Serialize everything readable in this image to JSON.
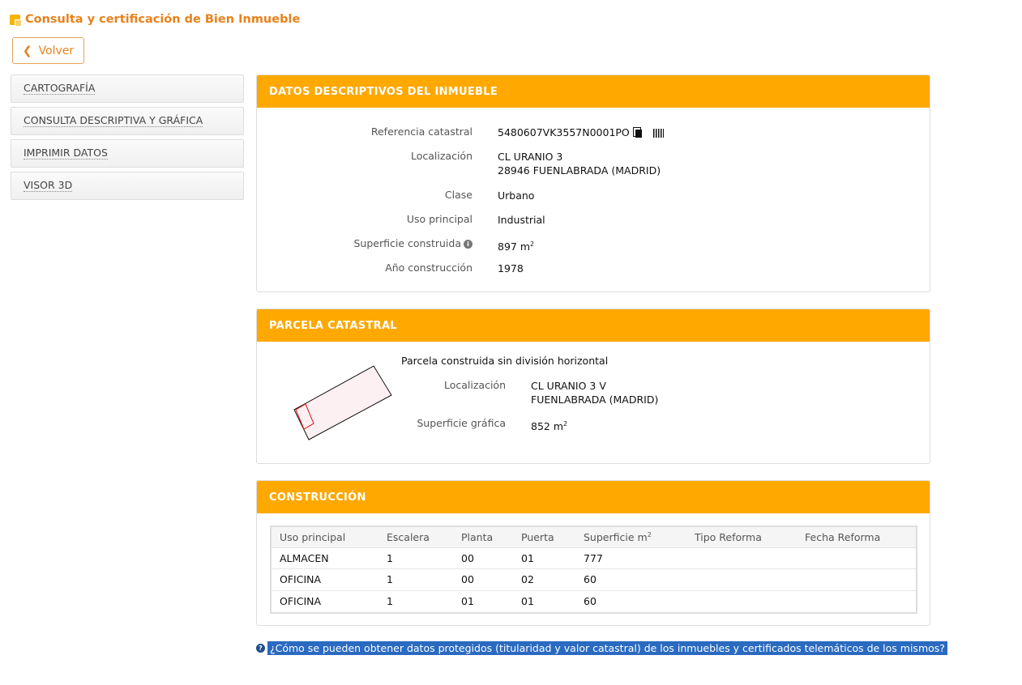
{
  "header": {
    "title": "Consulta y certificación de Bien Inmueble",
    "back_label": "Volver"
  },
  "sidebar": {
    "items": [
      {
        "label": "CARTOGRAFÍA"
      },
      {
        "label": "CONSULTA DESCRIPTIVA Y GRÁFICA"
      },
      {
        "label": "IMPRIMIR DATOS"
      },
      {
        "label": "VISOR 3D"
      }
    ]
  },
  "descriptive": {
    "heading": "DATOS DESCRIPTIVOS DEL INMUEBLE",
    "ref_label": "Referencia catastral",
    "ref_value": "5480607VK3557N0001PO",
    "loc_label": "Localización",
    "loc_line1": "CL URANIO 3",
    "loc_line2": "28946 FUENLABRADA (MADRID)",
    "class_label": "Clase",
    "class_value": "Urbano",
    "use_label": "Uso principal",
    "use_value": "Industrial",
    "area_label": "Superficie construida",
    "area_value": "897 m",
    "area_unit_exp": "2",
    "year_label": "Año construcción",
    "year_value": "1978"
  },
  "parcel": {
    "heading": "PARCELA CATASTRAL",
    "subtitle": "Parcela construida sin división horizontal",
    "loc_label": "Localización",
    "loc_line1": "CL URANIO 3 V",
    "loc_line2": "FUENLABRADA (MADRID)",
    "area_label": "Superficie gráfica",
    "area_value": "852 m",
    "area_unit_exp": "2"
  },
  "construction": {
    "heading": "CONSTRUCCIÓN",
    "columns": [
      "Uso principal",
      "Escalera",
      "Planta",
      "Puerta",
      "Superficie m",
      "Tipo Reforma",
      "Fecha Reforma"
    ],
    "area_col_exp": "2",
    "rows": [
      [
        "ALMACEN",
        "1",
        "00",
        "01",
        "777",
        "",
        ""
      ],
      [
        "OFICINA",
        "1",
        "00",
        "02",
        "60",
        "",
        ""
      ],
      [
        "OFICINA",
        "1",
        "01",
        "01",
        "60",
        "",
        ""
      ]
    ]
  },
  "help": {
    "link": "¿Cómo se pueden obtener datos protegidos (titularidad y valor catastral) de los inmuebles y certificados telemáticos de los mismos?"
  },
  "colors": {
    "accent": "#ffa800",
    "title": "#e8821c",
    "link_bg": "#2a6ac0"
  }
}
